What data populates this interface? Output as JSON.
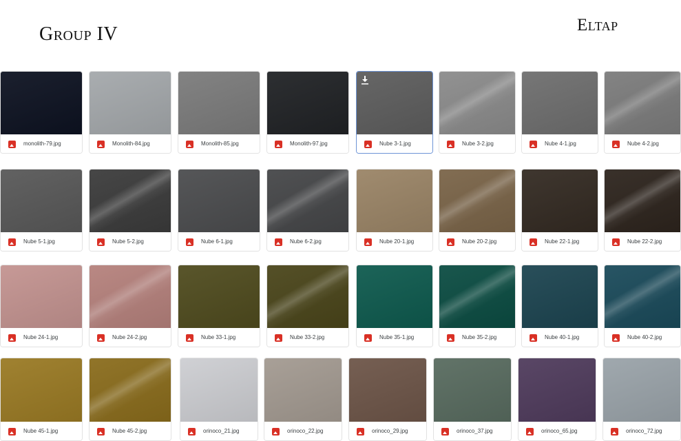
{
  "header": {
    "group_title": "Group IV",
    "brand": "Eltap"
  },
  "colors": {
    "selected_border": "#6c93d6",
    "image_icon": "#d93025"
  },
  "rows": [
    {
      "tiles": [
        {
          "file": "monolith-79.jpg",
          "color": "#0d1221"
        },
        {
          "file": "Monolith-84.jpg",
          "color": "#a4a8ab"
        },
        {
          "file": "Monolith-85.jpg",
          "color": "#7b7b7b"
        },
        {
          "file": "Monolith-97.jpg",
          "color": "#202225"
        },
        {
          "file": "Nube 3-1.jpg",
          "color": "#5d5d5d",
          "selected": true,
          "icon": "download-icon"
        },
        {
          "file": "Nube 3-2.jpg",
          "color": "#8b8b8b",
          "sheen": true
        },
        {
          "file": "Nube 4-1.jpg",
          "color": "#6e6e6e"
        },
        {
          "file": "Nube 4-2.jpg",
          "color": "#7c7c7c",
          "sheen": true
        }
      ]
    },
    {
      "tiles": [
        {
          "file": "Nube 5-1.jpg",
          "color": "#585858"
        },
        {
          "file": "Nube 5-2.jpg",
          "color": "#3b3b3b",
          "sheen": true
        },
        {
          "file": "Nube 6-1.jpg",
          "color": "#4b4c4e"
        },
        {
          "file": "Nube 6-2.jpg",
          "color": "#454648",
          "sheen": true
        },
        {
          "file": "Nube 20-1.jpg",
          "color": "#9a8466"
        },
        {
          "file": "Nube 20-2.jpg",
          "color": "#7a6448",
          "sheen": true
        },
        {
          "file": "Nube 22-1.jpg",
          "color": "#332a22"
        },
        {
          "file": "Nube 22-2.jpg",
          "color": "#2d241d",
          "sheen": true
        }
      ]
    },
    {
      "tiles": [
        {
          "file": "Nube 24-1.jpg",
          "color": "#c39390"
        },
        {
          "file": "Nube 24-2.jpg",
          "color": "#b5817c",
          "sheen": true
        },
        {
          "file": "Nube 33-1.jpg",
          "color": "#4f4b1e"
        },
        {
          "file": "Nube 33-2.jpg",
          "color": "#4a451a",
          "sheen": true
        },
        {
          "file": "Nube 35-1.jpg",
          "color": "#0e5a4e"
        },
        {
          "file": "Nube 35-2.jpg",
          "color": "#0b4c42",
          "sheen": true
        },
        {
          "file": "Nube 40-1.jpg",
          "color": "#1c4450"
        },
        {
          "file": "Nube 40-2.jpg",
          "color": "#1a4a5a",
          "sheen": true
        }
      ]
    },
    {
      "tiles": [
        {
          "file": "Nube 45-1.jpg",
          "color": "#9a7a24"
        },
        {
          "file": "Nube 45-2.jpg",
          "color": "#8a6c1c",
          "sheen": true
        },
        {
          "file": "orinoco_21.jpg",
          "color": "#cdced2"
        },
        {
          "file": "orinoco_22.jpg",
          "color": "#a39a91"
        },
        {
          "file": "orinoco_29.jpg",
          "color": "#6d5548"
        },
        {
          "file": "orinoco_37.jpg",
          "color": "#586b5f"
        },
        {
          "file": "orinoco_65.jpg",
          "color": "#4f3b5c"
        },
        {
          "file": "orinoco_72.jpg",
          "color": "#9aa3a9"
        }
      ]
    }
  ]
}
